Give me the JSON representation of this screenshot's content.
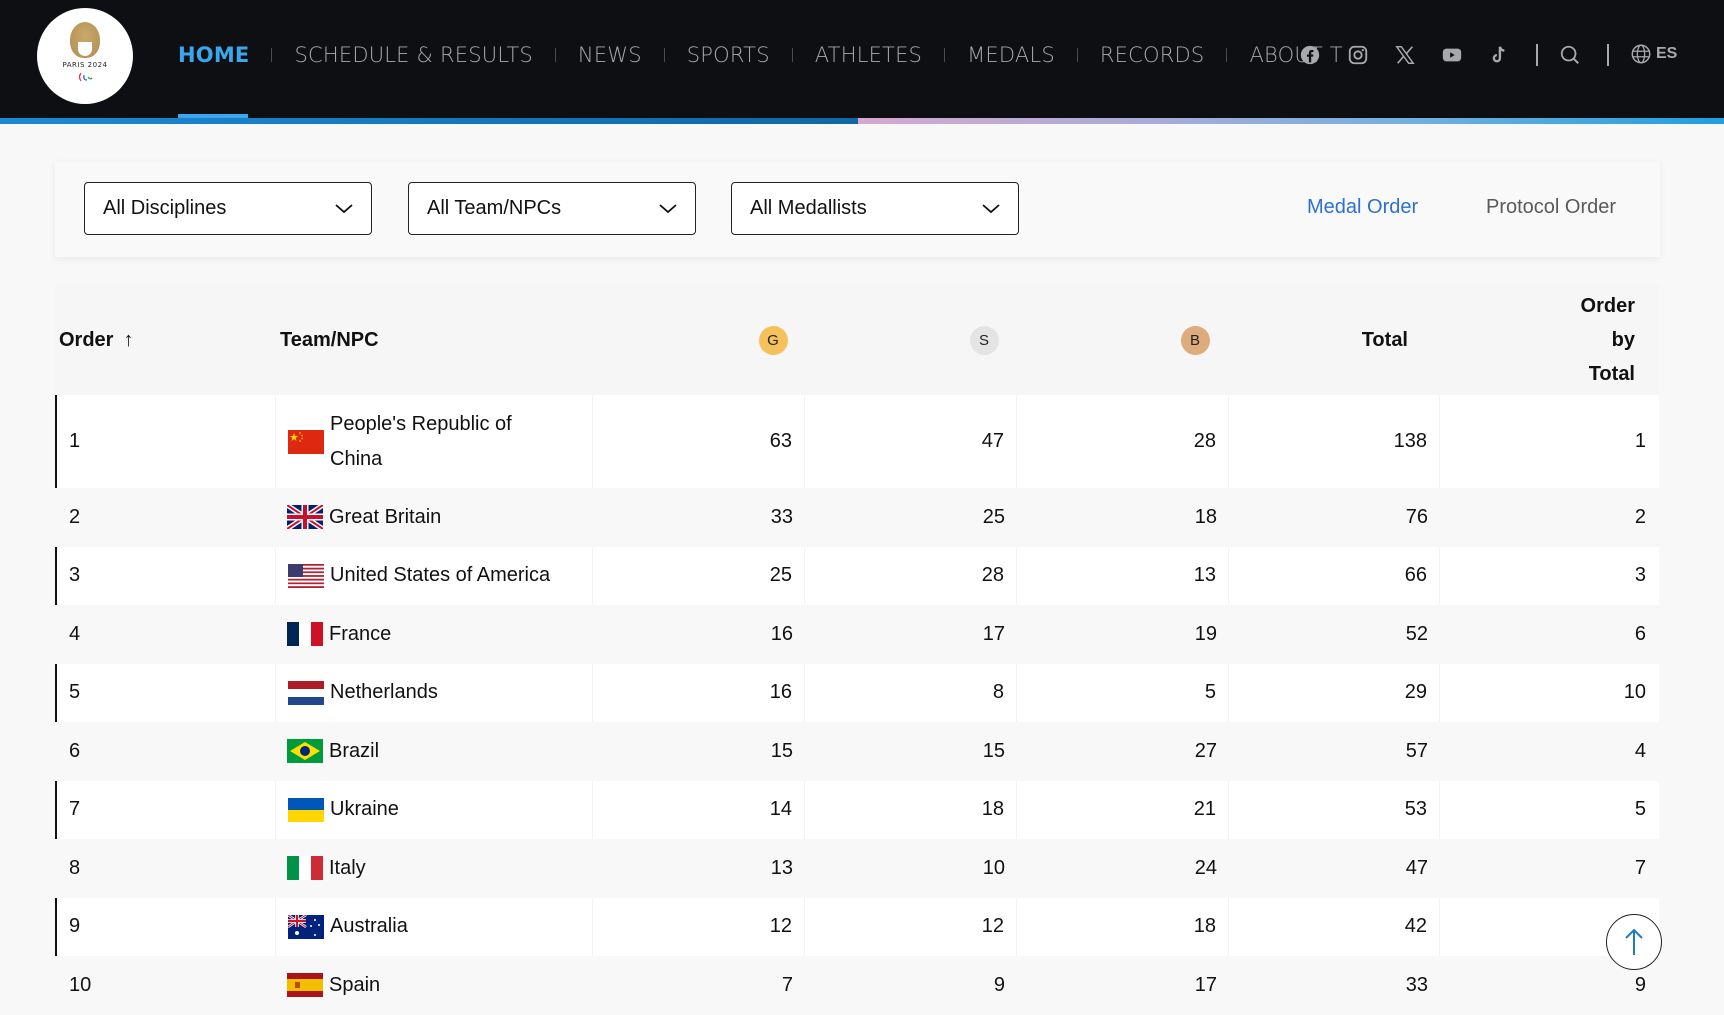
{
  "header": {
    "logo_text": "PARIS 2024",
    "nav": [
      {
        "label": "HOME",
        "active": true
      },
      {
        "label": "SCHEDULE & RESULTS"
      },
      {
        "label": "NEWS"
      },
      {
        "label": "SPORTS"
      },
      {
        "label": "ATHLETES"
      },
      {
        "label": "MEDALS"
      },
      {
        "label": "RECORDS"
      },
      {
        "label": "ABOUT T"
      }
    ],
    "social_icons": [
      "facebook-icon",
      "instagram-icon",
      "x-icon",
      "youtube-icon",
      "tiktok-icon"
    ],
    "search_icon": "search-icon",
    "language": "ES",
    "colors": {
      "background": "#0e0f12",
      "active": "#3ba6ec",
      "nav_text": "#a7a9ad"
    }
  },
  "filters": {
    "disciplines": "All Disciplines",
    "teams": "All Team/NPCs",
    "medallists": "All Medallists",
    "medal_order": "Medal Order",
    "protocol_order": "Protocol Order",
    "active_order": "Medal Order"
  },
  "table": {
    "headers": {
      "order": "Order",
      "order_sort": "↑",
      "team": "Team/NPC",
      "gold": "G",
      "silver": "S",
      "bronze": "B",
      "total": "Total",
      "order_by_total": [
        "Order",
        "by",
        "Total"
      ]
    },
    "medal_colors": {
      "gold": "#f5c15a",
      "silver": "#e4e4e4",
      "bronze": "#deab7c"
    },
    "rows": [
      {
        "order": "1",
        "team": "People's Republic of China",
        "flag": "china",
        "gold": "63",
        "silver": "47",
        "bronze": "28",
        "total": "138",
        "order_by_total": "1"
      },
      {
        "order": "2",
        "team": "Great Britain",
        "flag": "gb",
        "gold": "33",
        "silver": "25",
        "bronze": "18",
        "total": "76",
        "order_by_total": "2"
      },
      {
        "order": "3",
        "team": "United States of America",
        "flag": "usa",
        "gold": "25",
        "silver": "28",
        "bronze": "13",
        "total": "66",
        "order_by_total": "3"
      },
      {
        "order": "4",
        "team": "France",
        "flag": "france",
        "gold": "16",
        "silver": "17",
        "bronze": "19",
        "total": "52",
        "order_by_total": "6"
      },
      {
        "order": "5",
        "team": "Netherlands",
        "flag": "netherlands",
        "gold": "16",
        "silver": "8",
        "bronze": "5",
        "total": "29",
        "order_by_total": "10"
      },
      {
        "order": "6",
        "team": "Brazil",
        "flag": "brazil",
        "gold": "15",
        "silver": "15",
        "bronze": "27",
        "total": "57",
        "order_by_total": "4"
      },
      {
        "order": "7",
        "team": "Ukraine",
        "flag": "ukraine",
        "gold": "14",
        "silver": "18",
        "bronze": "21",
        "total": "53",
        "order_by_total": "5"
      },
      {
        "order": "8",
        "team": "Italy",
        "flag": "italy",
        "gold": "13",
        "silver": "10",
        "bronze": "24",
        "total": "47",
        "order_by_total": "7"
      },
      {
        "order": "9",
        "team": "Australia",
        "flag": "australia",
        "gold": "12",
        "silver": "12",
        "bronze": "18",
        "total": "42",
        "order_by_total": ""
      },
      {
        "order": "10",
        "team": "Spain",
        "flag": "spain",
        "gold": "7",
        "silver": "9",
        "bronze": "17",
        "total": "33",
        "order_by_total": "9"
      }
    ]
  },
  "scroll_to_top": "arrow-up-icon"
}
